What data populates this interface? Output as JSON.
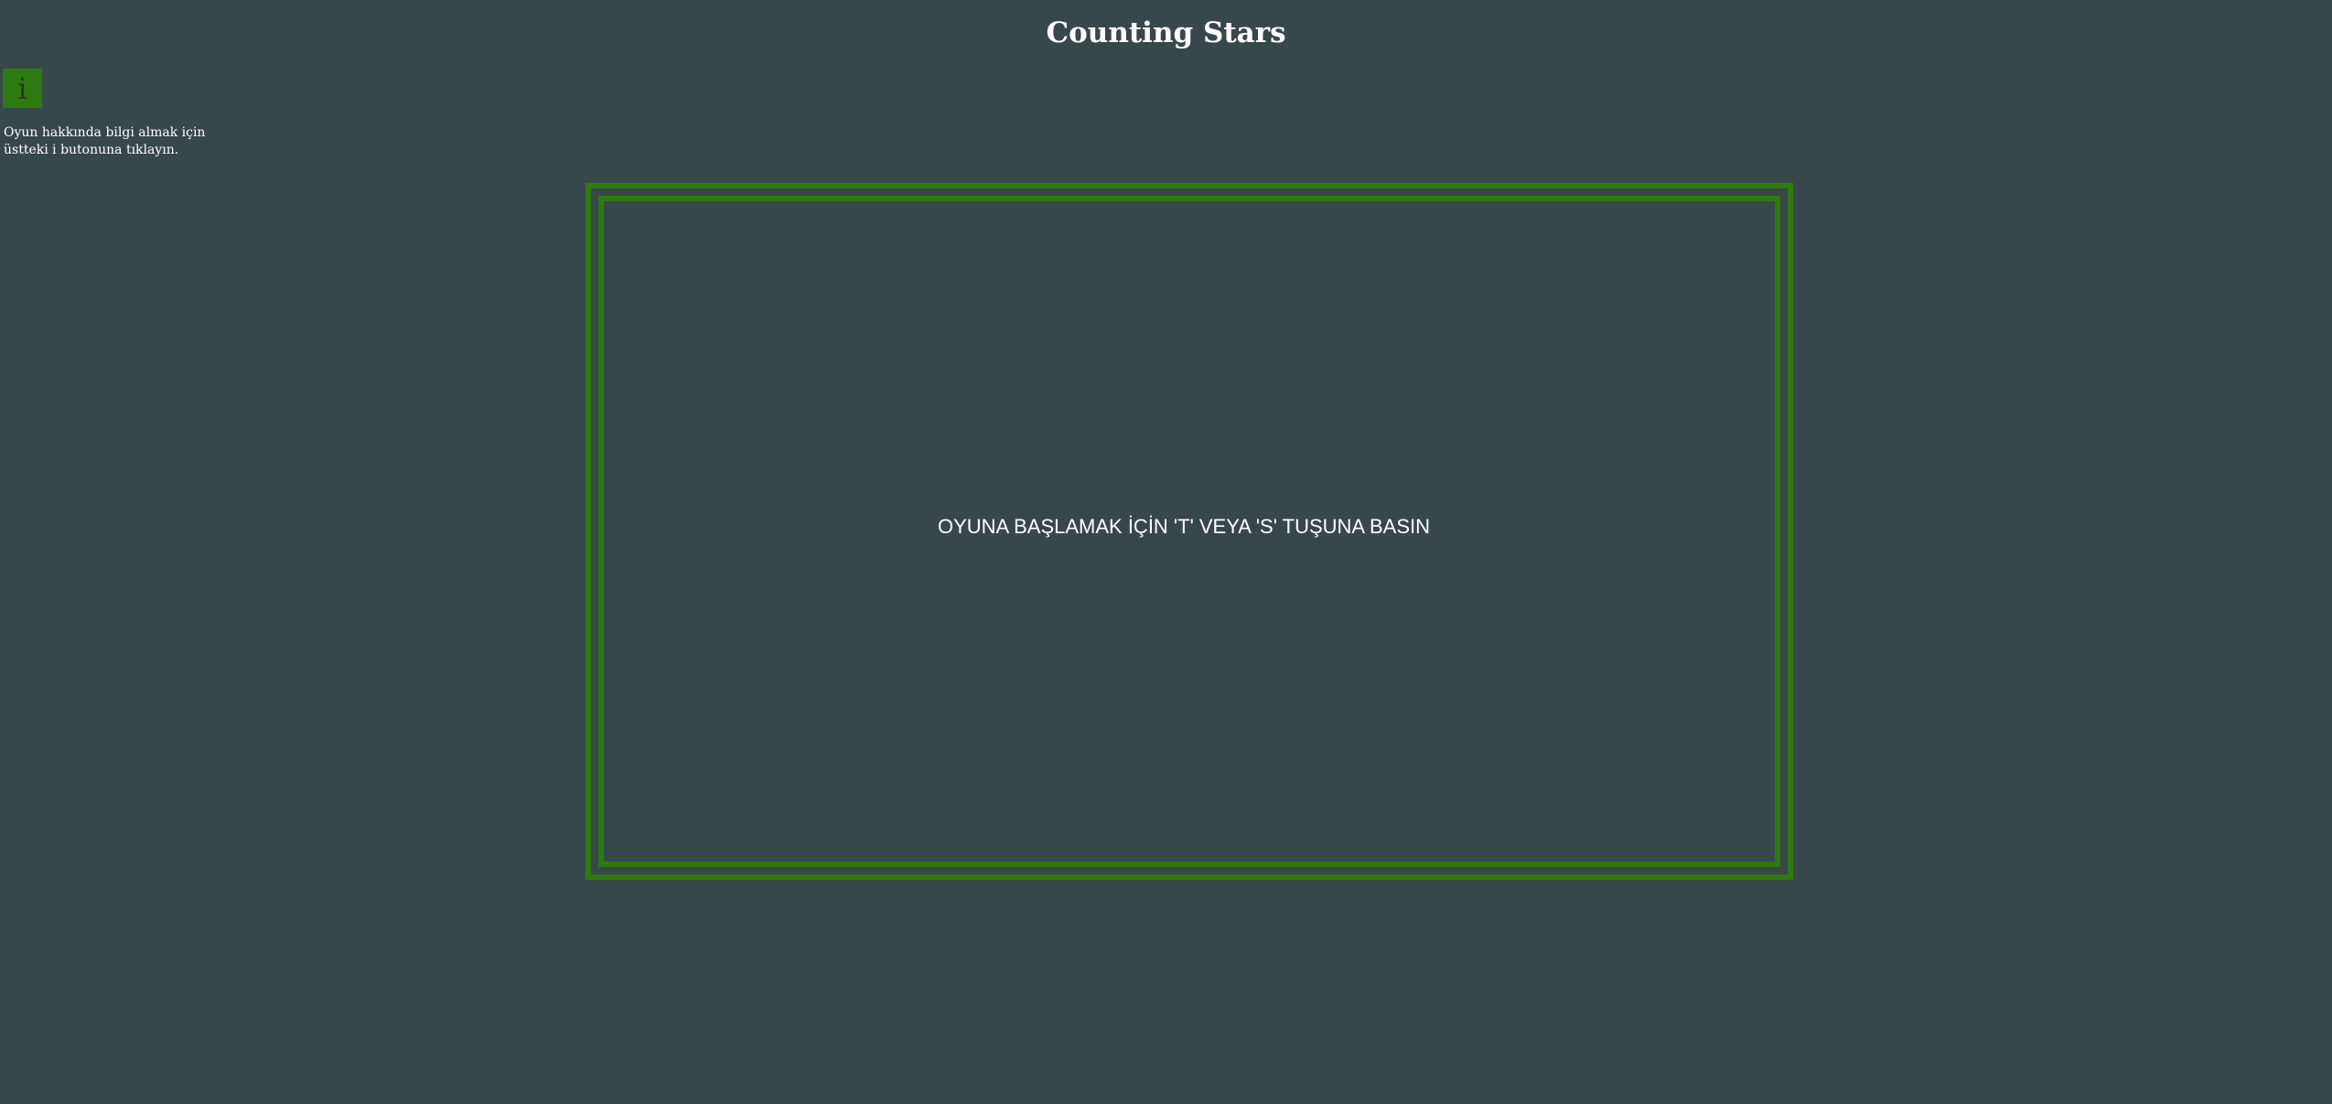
{
  "page": {
    "title": "Counting Stars"
  },
  "info": {
    "button_label": "i",
    "help_line_1": "Oyun hakkında bilgi almak için",
    "help_line_2": "üstteki i butonuna tıklayın."
  },
  "game": {
    "start_message": "OYUNA BAŞLAMAK İÇİN 'T' VEYA 'S' TUŞUNA BASIN"
  },
  "colors": {
    "background": "#37484a",
    "accent_green": "#2f7a10",
    "text": "#ffffff"
  }
}
